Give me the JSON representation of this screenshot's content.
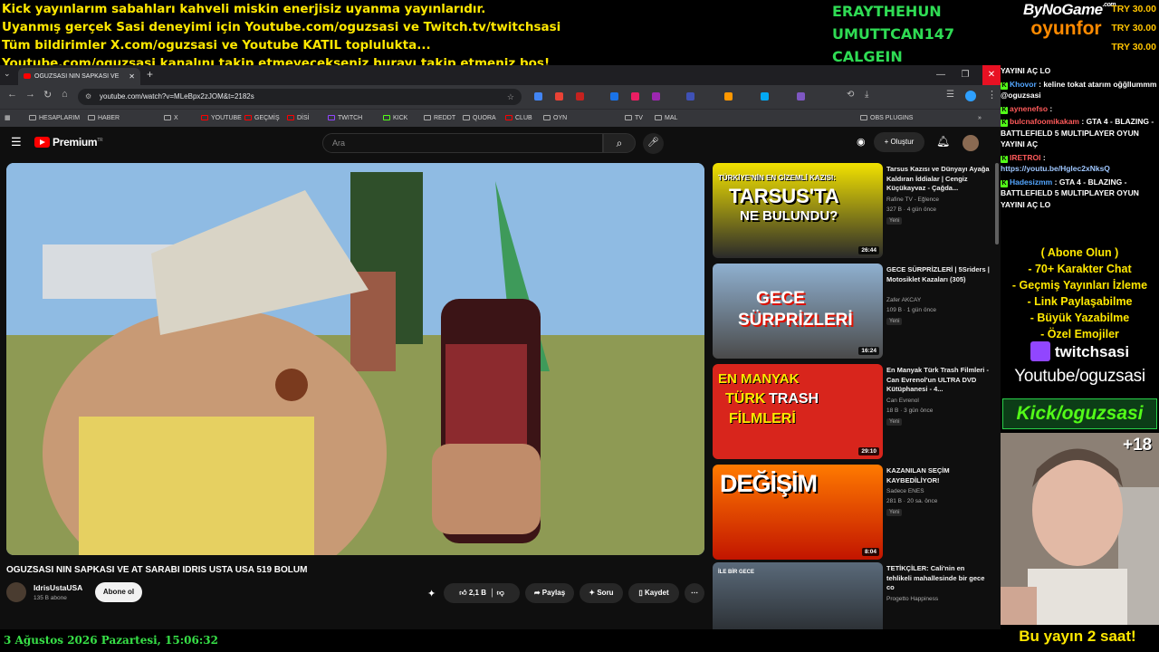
{
  "overlay": {
    "ticker": [
      "Kick yayınlarım sabahları kahveli miskin enerjisiz uyanma yayınlarıdır.",
      "Uyanmış gerçek Sasi deneyimi için Youtube.com/oguzsasi ve Twitch.tv/twitchsasi",
      "Tüm bildirimler X.com/oguzsasi ve Youtube KATIL toplulukta...",
      "Youtube.com/oguzsasi kanalını takip etmeyecekseniz burayı takip etmeniz boş!"
    ],
    "recent_subs": [
      "ERAYTHEHUN",
      "UMUTTCAN147",
      "CALGEIN"
    ],
    "sponsor_logo": {
      "line1": "ByNoGame",
      "line1_suffix": ".com",
      "line2": "oyunfor"
    },
    "donations": [
      "TRY 30.00",
      "TRY 30.00",
      "TRY 30.00"
    ],
    "datetime": "3 Ağustos 2026 Pazartesi, 15:06:32",
    "stream_duration": "Bu yayın 2 saat!",
    "age_badge": "+18"
  },
  "browser": {
    "tab_title": "OGUZSASI NIN SAPKASI VE",
    "url": "youtube.com/watch?v=MLeBpx2zJOM&t=2182s",
    "bookmarks": [
      "HESAPLARIM",
      "HABER",
      "X",
      "YOUTUBE",
      "GEÇMİŞ",
      "DİSİ",
      "TWITCH",
      "KICK",
      "REDDT",
      "QUORA",
      "CLUB",
      "OYN",
      "TV",
      "MAL",
      "OBS PLUGINS"
    ]
  },
  "youtube": {
    "logo": "Premium",
    "logo_suffix": "TR",
    "search_placeholder": "Ara",
    "create_label": "Oluştur",
    "video_title": "OGUZSASI NIN SAPKASI VE AT SARABI IDRIS USTA USA 519 BOLUM",
    "channel": "IdrisUstaUSA",
    "channel_subs": "135 B abone",
    "subscribe_label": "Abone ol",
    "likes": "2,1 B",
    "share_label": "Paylaş",
    "ask_label": "Soru",
    "save_label": "Kaydet",
    "recommended": [
      {
        "title": "Tarsus Kazısı ve Dünyayı Ayağa Kaldıran İddialar | Cengiz Küçükayvaz - Çağda...",
        "channel": "Rafine TV - Eğlence",
        "meta": "327 B · 4 gün önce",
        "badge": "Yeni",
        "duration": "26:44",
        "thumb_text": [
          "TÜRKİYE'NİN EN GİZEMLİ KAZISI:",
          "TARSUS'TA",
          "NE BULUNDU?"
        ]
      },
      {
        "title": "GECE SÜRPRİZLERİ | 5Sriders | Motosiklet Kazaları (305)",
        "channel": "Zafer AKCAY",
        "meta": "109 B · 1 gün önce",
        "badge": "Yeni",
        "duration": "16:24",
        "thumb_text": [
          "GECE",
          "SÜRPRİZLERİ"
        ]
      },
      {
        "title": "En Manyak Türk Trash Filmleri - Can Evrenol'un ULTRA DVD Kütüphanesi - 4...",
        "channel": "Can Evrenol",
        "meta": "18 B · 3 gün önce",
        "badge": "Yeni",
        "duration": "29:10",
        "thumb_text": [
          "EN MANYAK",
          "TÜRK",
          "TRASH",
          "FİLMLERİ"
        ]
      },
      {
        "title": "KAZANILAN SEÇİM KAYBEDİLİYOR!",
        "channel": "Sadece ENES",
        "meta": "281 B · 20 sa. önce",
        "badge": "Yeni",
        "duration": "8:04",
        "thumb_text": [
          "DEĞİŞİM"
        ]
      },
      {
        "title": "TETİKÇİLER: Cali'nin en tehlikeli mahallesinde bir gece co",
        "channel": "Progetto Happiness",
        "meta": "",
        "badge": "",
        "duration": "",
        "thumb_text": [
          "İLE BİR GECE"
        ]
      }
    ]
  },
  "chat": {
    "messages": [
      {
        "user": "",
        "text": "YAYINI AÇ LO"
      },
      {
        "user": "Khovor",
        "text": ": keline tokat atarım oğğllummm @oguzsasi"
      },
      {
        "user": "aynenefso",
        "text": ":"
      },
      {
        "user": "bulcnafoomikakam",
        "text": ": GTA 4 - BLAZING - BATTLEFIELD 5 MULTIPLAYER OYUN YAYINI AÇ"
      },
      {
        "user": "IRETROI",
        "text": ":"
      },
      {
        "user": "",
        "text": "https://youtu.be/Hglec2xNksQ"
      },
      {
        "user": "Hadesizmm",
        "text": ": GTA 4 - BLAZING - BATTLEFIELD 5 MULTIPLAYER OYUN YAYINI AÇ LO"
      }
    ]
  },
  "promo": {
    "lines": [
      "( Abone Olun )",
      "- 70+ Karakter Chat",
      "- Geçmiş Yayınları İzleme",
      "- Link Paylaşabilme",
      "- Büyük Yazabilme",
      "- Özel Emojiler"
    ],
    "twitch": "twitchsasi",
    "youtube": "Youtube/oguzsasi",
    "kick": "Kick/oguzsasi"
  }
}
